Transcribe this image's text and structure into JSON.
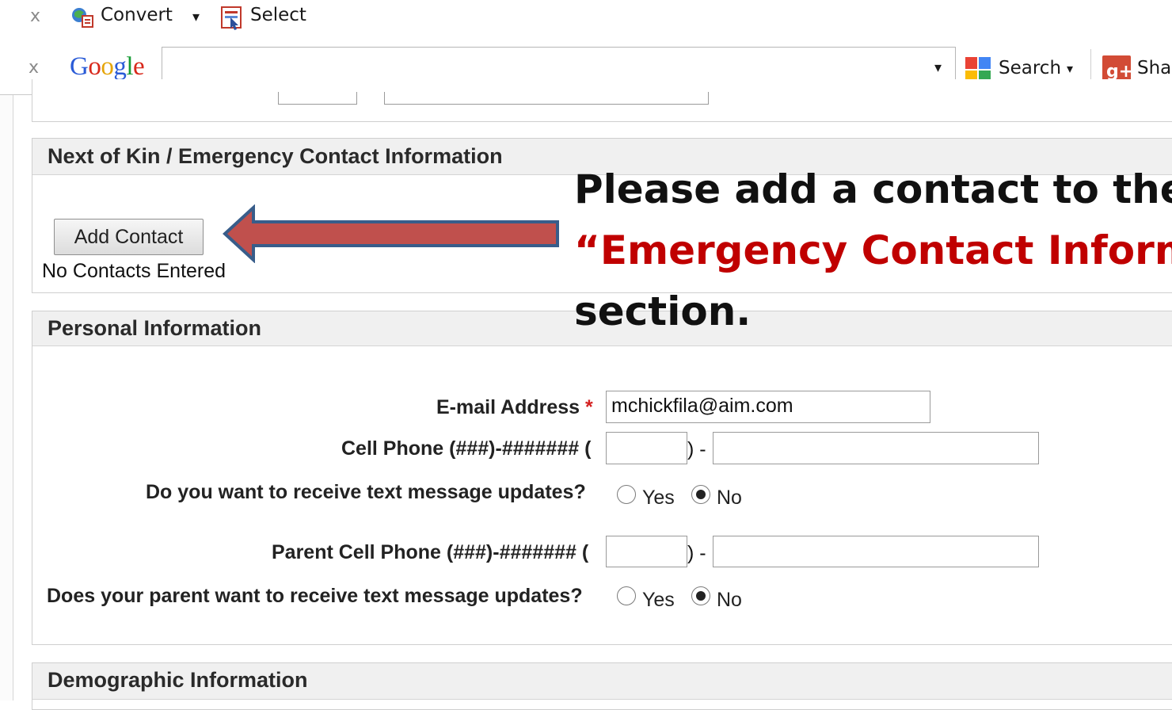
{
  "toolbar1": {
    "close": "x",
    "convert_label": "Convert",
    "dropdown": "▾",
    "select_label": "Select"
  },
  "toolbar2": {
    "close": "x",
    "google_letters": [
      "G",
      "o",
      "o",
      "g",
      "l",
      "e"
    ],
    "search_value": "",
    "dropdown": "▾",
    "search_label": "Search",
    "share_label": "Sha"
  },
  "kin_section": {
    "title": "Next of Kin / Emergency Contact Information",
    "add_button": "Add Contact",
    "no_contacts": "No Contacts Entered"
  },
  "personal_section": {
    "title": "Personal Information",
    "email": {
      "label": "E-mail Address",
      "required": "*",
      "value": "mchickfila@aim.com"
    },
    "cell": {
      "label": "Cell Phone (###)-####### (",
      "separator": ") -",
      "area": "",
      "number": ""
    },
    "text_updates": {
      "question": "Do you want to receive text message updates?",
      "yes": "Yes",
      "no": "No",
      "selected": "No"
    },
    "parent_cell": {
      "label": "Parent Cell Phone (###)-####### (",
      "separator": ") -",
      "area": "",
      "number": ""
    },
    "parent_updates": {
      "question": "Does your parent want to receive text message updates?",
      "yes": "Yes",
      "no": "No",
      "selected": "No"
    }
  },
  "demographic_section": {
    "title": "Demographic Information"
  },
  "annotation": {
    "line1": "Please add a contact to the",
    "line2": "“Emergency Contact Informa",
    "line3": "section."
  },
  "colors": {
    "annotation_red": "#c00000",
    "arrow_fill": "#c0504d",
    "arrow_border": "#385d8a"
  }
}
